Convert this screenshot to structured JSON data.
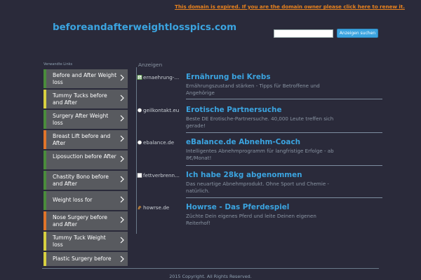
{
  "header": {
    "expired_notice": "This domain is expired. If you are the domain owner please click here to renew it.",
    "site_title": "beforeandafterweightlosspics.com",
    "search_placeholder": "",
    "search_button": "Anzeigen suchen"
  },
  "sidebar": {
    "heading": "Verwandte Links",
    "items": [
      {
        "label": "Before and After Weight loss",
        "accent": "#4a8c3c"
      },
      {
        "label": "Tummy Tucks before and After",
        "accent": "#d7d040"
      },
      {
        "label": "Surgery After Weight loss",
        "accent": "#4a8c3c"
      },
      {
        "label": "Breast Lift before and After",
        "accent": "#e0742a"
      },
      {
        "label": "Liposuction before After",
        "accent": "#4a8c3c"
      },
      {
        "label": "Chastity Bono before and After",
        "accent": "#4a8c3c"
      },
      {
        "label": "Weight loss for",
        "accent": "#4a8c3c"
      },
      {
        "label": "Nose Surgery before and After",
        "accent": "#e0742a"
      },
      {
        "label": "Tummy Tuck Weight loss",
        "accent": "#d7d040"
      },
      {
        "label": "Plastic Surgery before",
        "accent": "#d7d040"
      }
    ]
  },
  "ads": {
    "label": "Anzeigen",
    "items": [
      {
        "domain": "ernaehrung-...",
        "title": "Ernährung bei Krebs",
        "desc": "Ernährungszustand stärken - Tipps für Betroffene und Angehörige",
        "favicon": "b-icon"
      },
      {
        "domain": "geilkontakt.eu",
        "title": "Erotische Partnersuche",
        "desc": "Beste DE Erotische-Partnersuche. 40,000 Leute treffen sich gerade!",
        "favicon": "circle-icon"
      },
      {
        "domain": "ebalance.de",
        "title": "eBalance.de Abnehm-Coach",
        "desc": "Intelligentes Abnehmprogramm für langfristige Erfolge - ab 8€/Monat!",
        "favicon": "circle-icon"
      },
      {
        "domain": "fettverbrenn...",
        "title": "Ich habe 28kg abgenommen",
        "desc": "Das neuartige Abnehmprodukt. Ohne Sport und Chemie - natürlich.",
        "favicon": "square-icon"
      },
      {
        "domain": "howrse.de",
        "title": "Howrse - Das Pferdespiel",
        "desc": "Züchte Dein eigenes Pferd und leite Deinen eigenen Reiterhof!",
        "favicon": "horse-icon"
      }
    ]
  },
  "footer": {
    "text": "2015 Copyright. All Rights Reserved."
  }
}
